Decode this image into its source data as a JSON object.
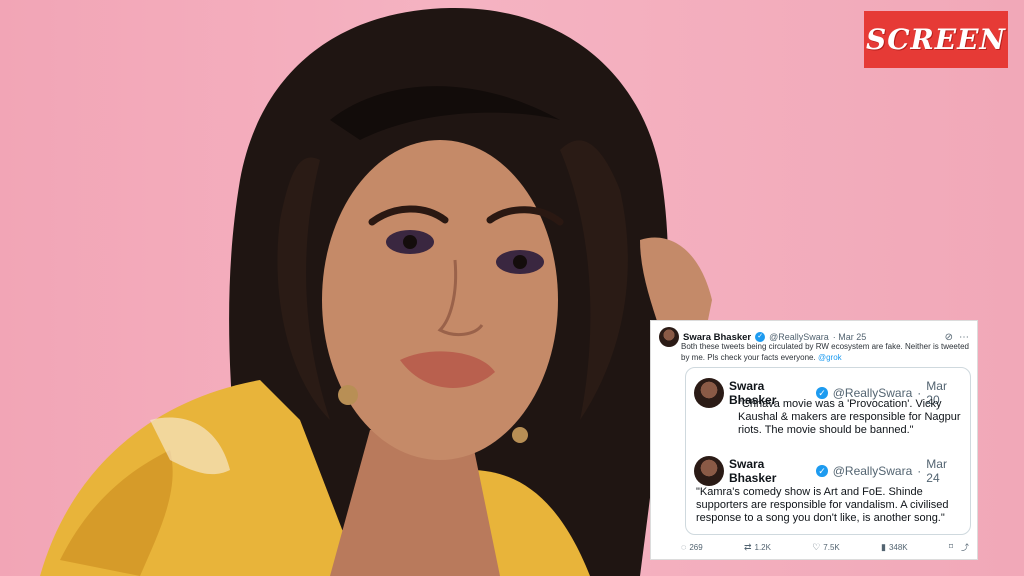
{
  "logo": {
    "text": "SCREEN",
    "bg_color": "#e63a36"
  },
  "main_tweet": {
    "author": "Swara Bhasker",
    "handle": "@ReallySwara",
    "date": "· Mar 25",
    "text": "Both these tweets being circulated by RW ecosystem are fake. Neither is tweeted by me. Pls check your facts everyone.",
    "mention": "@grok",
    "actions": {
      "replies": "269",
      "reposts": "1.2K",
      "likes": "7.5K",
      "views": "348K"
    }
  },
  "quoted_1": {
    "author": "Swara Bhasker",
    "handle": "@ReallySwara",
    "date": "Mar 20",
    "text": "\"Chhava movie was a 'Provocation'. Vicky Kaushal & makers are responsible for Nagpur riots. The movie should be banned.\""
  },
  "quoted_2": {
    "author": "Swara Bhasker",
    "handle": "@ReallySwara",
    "date": "Mar 24",
    "text": "\"Kamra's comedy show is Art and FoE. Shinde supporters are responsible for vandalism. A civilised response to a song you don't like, is another song.\""
  },
  "colors": {
    "accent": "#1d9bf0",
    "background": "#f3a9b9"
  }
}
